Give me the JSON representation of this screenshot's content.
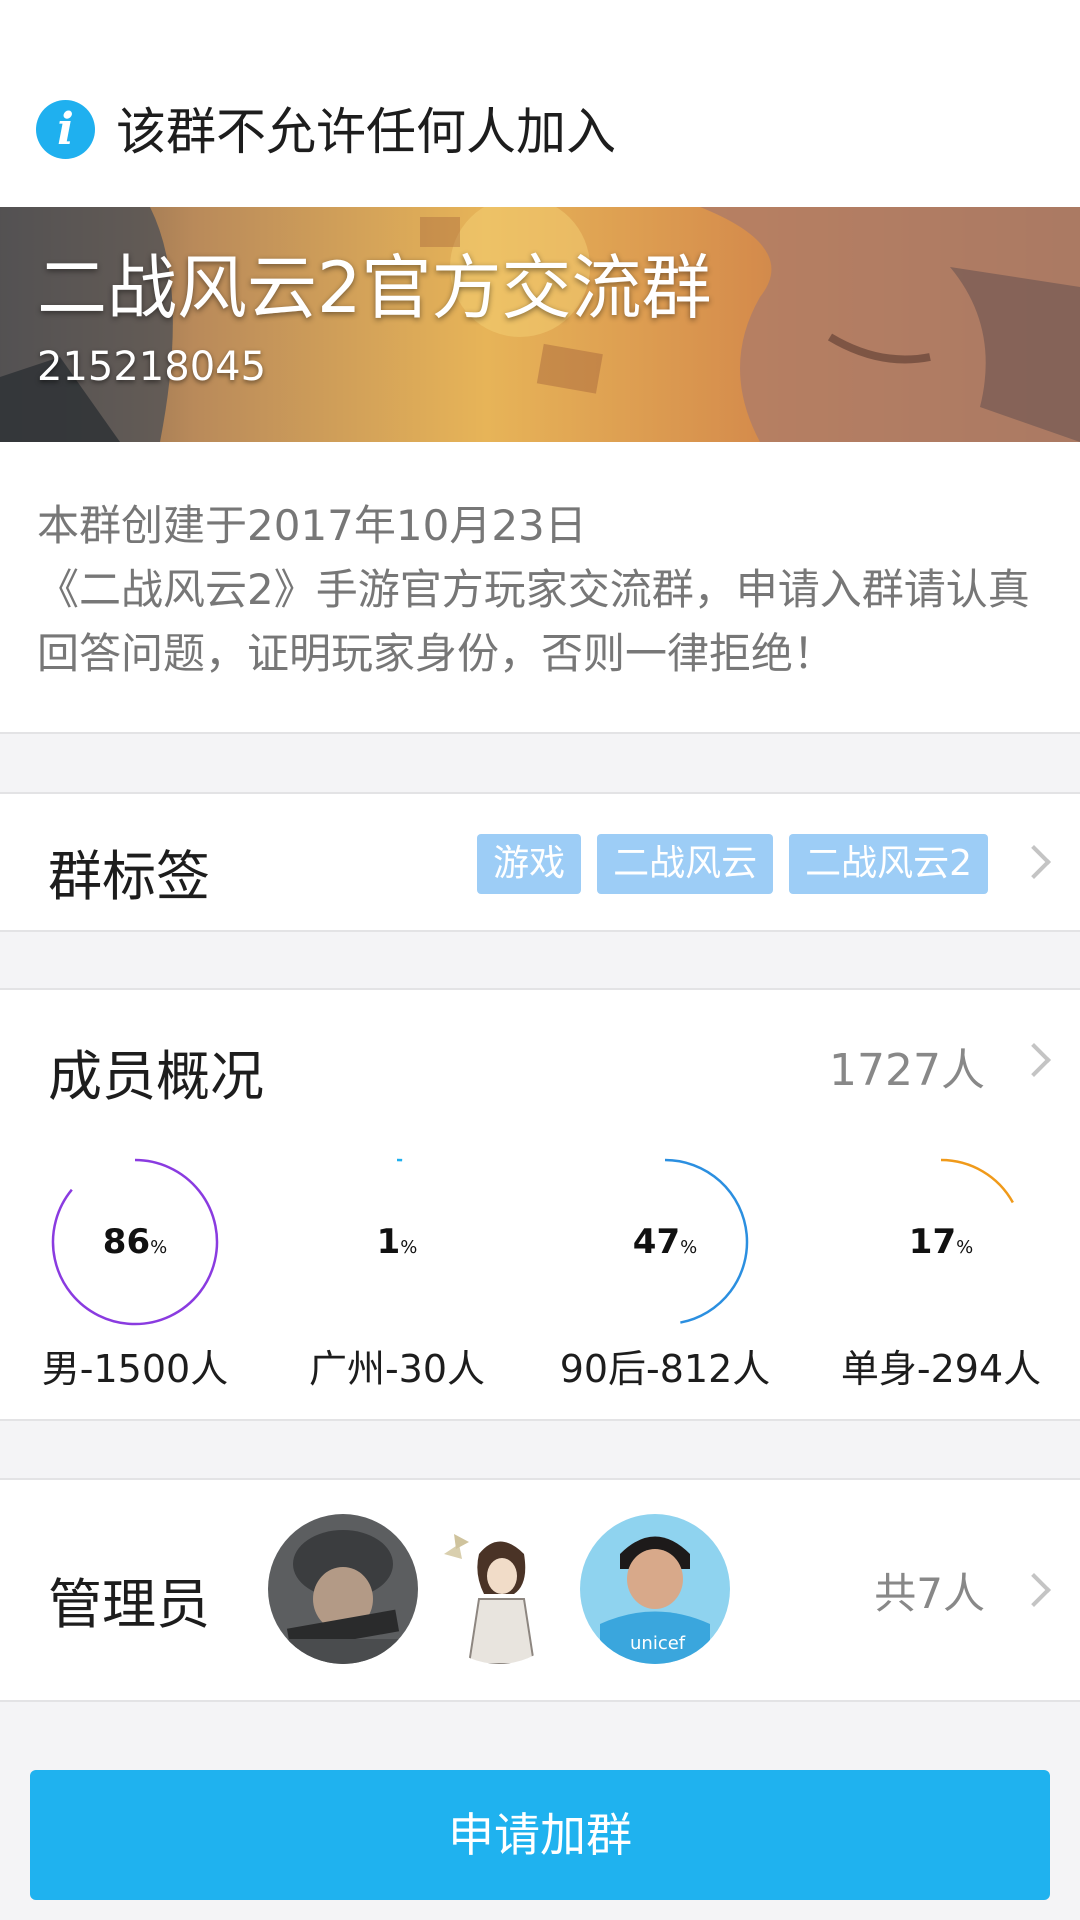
{
  "notice": {
    "icon": "info-icon",
    "text": "该群不允许任何人加入",
    "accent": "#1fb0ef"
  },
  "group": {
    "name": "二战风云2官方交流群",
    "id": "215218045"
  },
  "description": {
    "created": "本群创建于2017年10月23日",
    "body": "《二战风云2》手游官方玩家交流群，申请入群请认真回答问题，证明玩家身份，否则一律拒绝！"
  },
  "tags_section": {
    "title": "群标签",
    "tags": [
      "游戏",
      "二战风云",
      "二战风云2"
    ],
    "tag_color": "#9dcdf6"
  },
  "members": {
    "title": "成员概况",
    "count": "1727人",
    "stats": [
      {
        "percent": 86,
        "percent_text": "86",
        "unit": "%",
        "label": "男-1500人",
        "color": "#8a3be0"
      },
      {
        "percent": 1,
        "percent_text": "1",
        "unit": "%",
        "label": "广州-30人",
        "color": "#1fb0ef"
      },
      {
        "percent": 47,
        "percent_text": "47",
        "unit": "%",
        "label": "90后-812人",
        "color": "#2b8fe0"
      },
      {
        "percent": 17,
        "percent_text": "17",
        "unit": "%",
        "label": "单身-294人",
        "color": "#f09a1a"
      }
    ]
  },
  "admins": {
    "title": "管理员",
    "count": "共7人"
  },
  "join_button": {
    "label": "申请加群",
    "color": "#1fb2ef"
  }
}
